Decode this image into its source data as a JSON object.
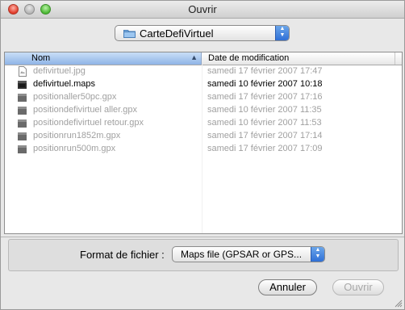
{
  "window": {
    "title": "Ouvrir"
  },
  "location": {
    "folder": "CarteDefiVirtuel"
  },
  "columns": {
    "name": "Nom",
    "date": "Date de modification"
  },
  "files": [
    {
      "name": "defivirtuel.jpg",
      "date": "samedi 17 février 2007 17:47",
      "enabled": false,
      "icon": "image-file-icon"
    },
    {
      "name": "defivirtuel.maps",
      "date": "samedi 10 février 2007 10:18",
      "enabled": true,
      "icon": "maps-file-icon"
    },
    {
      "name": "positionaller50pc.gpx",
      "date": "samedi 17 février 2007 17:16",
      "enabled": false,
      "icon": "gpx-file-icon"
    },
    {
      "name": "positiondefivirtuel aller.gpx",
      "date": "samedi 10 février 2007 11:35",
      "enabled": false,
      "icon": "gpx-file-icon"
    },
    {
      "name": "positiondefivirtuel retour.gpx",
      "date": "samedi 10 février 2007 11:53",
      "enabled": false,
      "icon": "gpx-file-icon"
    },
    {
      "name": "positionrun1852m.gpx",
      "date": "samedi 17 février 2007 17:14",
      "enabled": false,
      "icon": "gpx-file-icon"
    },
    {
      "name": "positionrun500m.gpx",
      "date": "samedi 17 février 2007 17:09",
      "enabled": false,
      "icon": "gpx-file-icon"
    }
  ],
  "format": {
    "label": "Format de fichier :",
    "selected": "Maps file (GPSAR or GPS..."
  },
  "buttons": {
    "cancel": "Annuler",
    "open": "Ouvrir"
  }
}
